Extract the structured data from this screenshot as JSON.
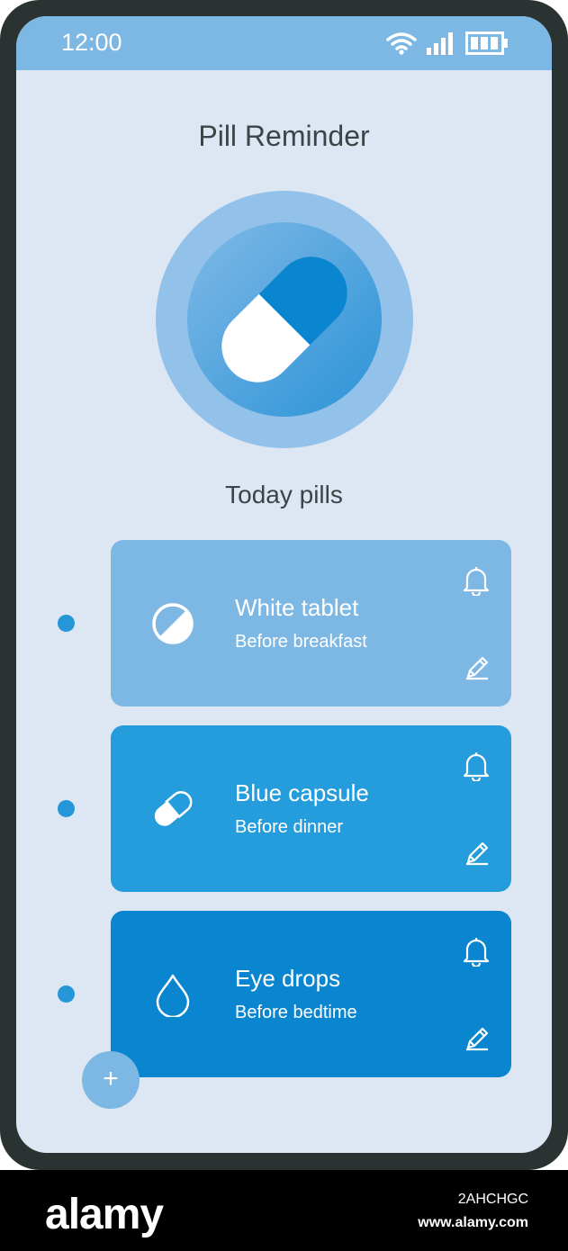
{
  "status_bar": {
    "time": "12:00"
  },
  "header": {
    "title": "Pill Reminder"
  },
  "hero": {
    "icon": "capsule-icon"
  },
  "section": {
    "title": "Today pills"
  },
  "pills": [
    {
      "name": "White tablet",
      "timing": "Before breakfast",
      "icon": "tablet-icon",
      "color": "#7db8e4"
    },
    {
      "name": "Blue capsule",
      "timing": "Before dinner",
      "icon": "capsule-icon",
      "color": "#259cdb"
    },
    {
      "name": "Eye drops",
      "timing": "Before bedtime",
      "icon": "drop-icon",
      "color": "#0a85cf"
    }
  ],
  "fab": {
    "label": "+"
  },
  "footer": {
    "brand": "alamy",
    "image_code": "2AHCHGC",
    "url": "www.alamy.com"
  },
  "colors": {
    "accent": "#2596d8",
    "background": "#dde7f3",
    "status_bar": "#7db8e4"
  }
}
